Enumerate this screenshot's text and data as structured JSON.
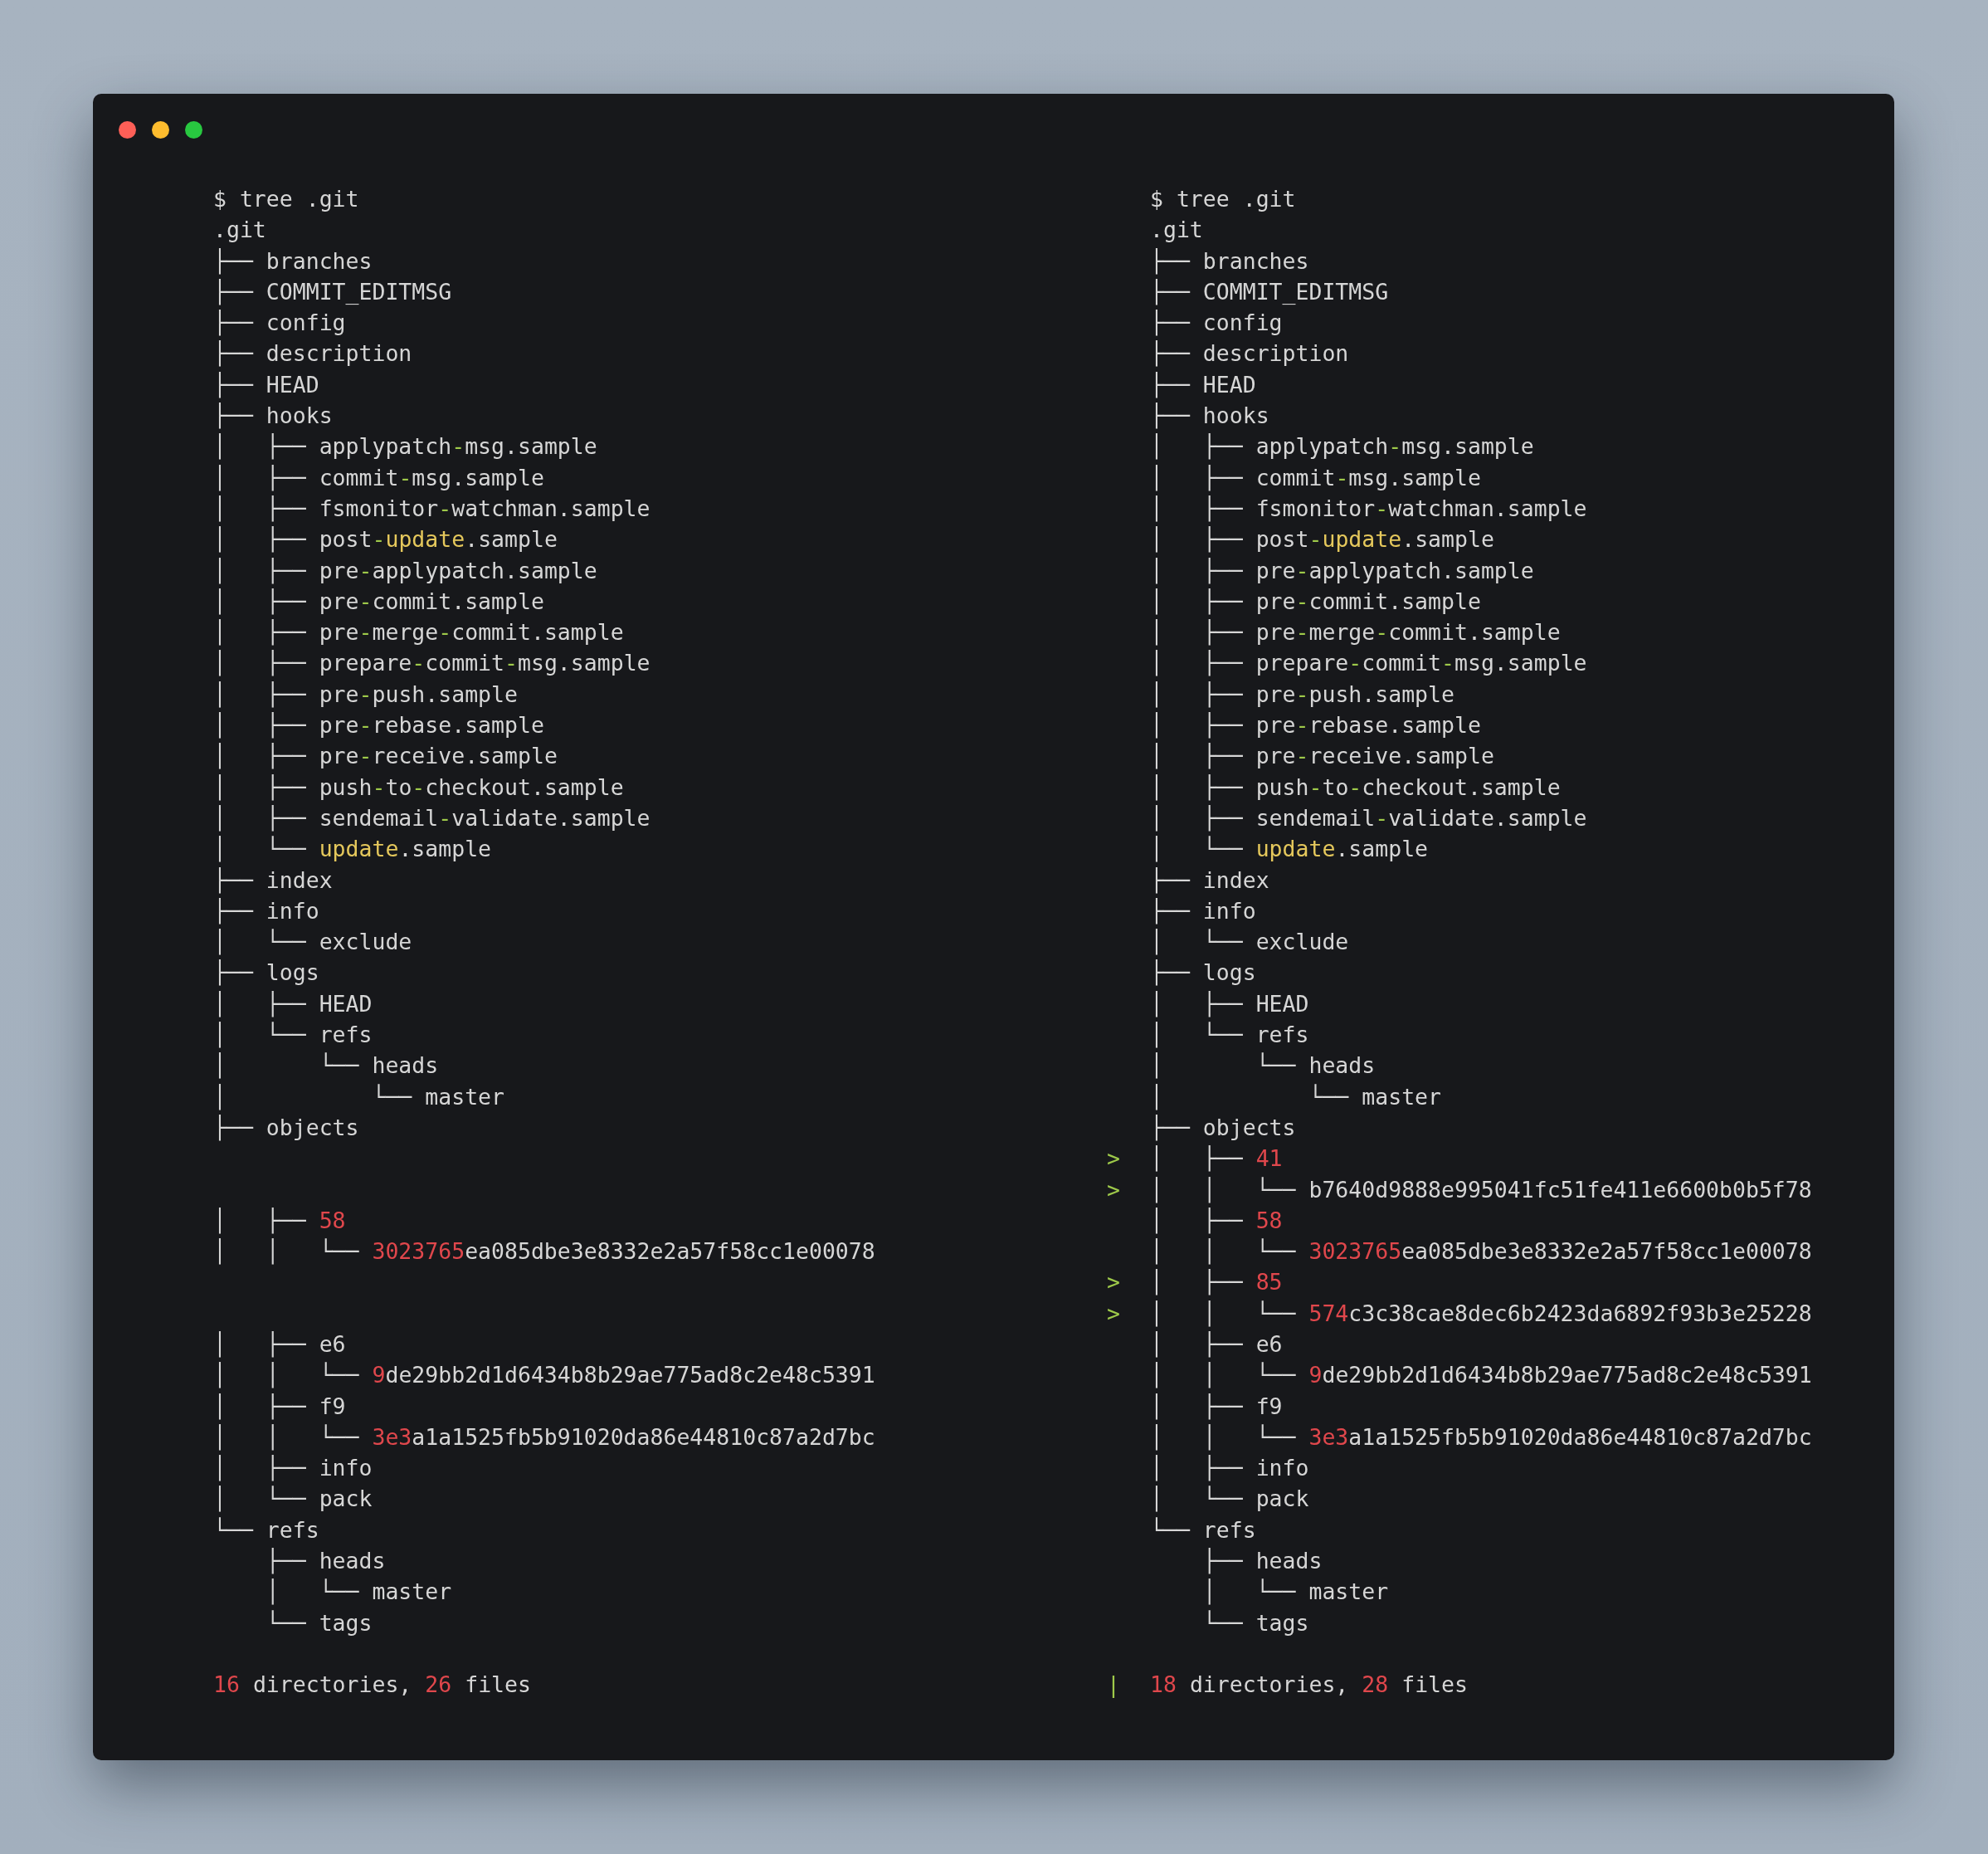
{
  "window": {
    "controls": [
      {
        "kind": "close"
      },
      {
        "kind": "minimize"
      },
      {
        "kind": "zoom"
      }
    ]
  },
  "panes": [
    {
      "rows": [
        {
          "parts": [
            {
              "text": "$ tree .git",
              "kind": "plain"
            }
          ]
        },
        {
          "parts": [
            {
              "text": ".git",
              "kind": "plain"
            }
          ]
        },
        {
          "tree": "├── ",
          "parts": [
            {
              "text": "branches",
              "kind": "plain"
            }
          ]
        },
        {
          "tree": "├── ",
          "parts": [
            {
              "text": "COMMIT_EDITMSG",
              "kind": "plain"
            }
          ]
        },
        {
          "tree": "├── ",
          "parts": [
            {
              "text": "config",
              "kind": "plain"
            }
          ]
        },
        {
          "tree": "├── ",
          "parts": [
            {
              "text": "description",
              "kind": "plain"
            }
          ]
        },
        {
          "tree": "├── ",
          "parts": [
            {
              "text": "HEAD",
              "kind": "plain"
            }
          ]
        },
        {
          "tree": "├── ",
          "parts": [
            {
              "text": "hooks",
              "kind": "plain"
            }
          ]
        },
        {
          "tree": "│   ├── ",
          "parts": [
            {
              "text": "applypatch",
              "kind": "plain"
            },
            {
              "text": "-",
              "kind": "dash"
            },
            {
              "text": "msg.sample",
              "kind": "plain"
            }
          ]
        },
        {
          "tree": "│   ├── ",
          "parts": [
            {
              "text": "commit",
              "kind": "plain"
            },
            {
              "text": "-",
              "kind": "dash"
            },
            {
              "text": "msg.sample",
              "kind": "plain"
            }
          ]
        },
        {
          "tree": "│   ├── ",
          "parts": [
            {
              "text": "fsmonitor",
              "kind": "plain"
            },
            {
              "text": "-",
              "kind": "dash"
            },
            {
              "text": "watchman.sample",
              "kind": "plain"
            }
          ]
        },
        {
          "tree": "│   ├── ",
          "parts": [
            {
              "text": "post",
              "kind": "plain"
            },
            {
              "text": "-",
              "kind": "dash"
            },
            {
              "text": "update",
              "kind": "keyword"
            },
            {
              "text": ".sample",
              "kind": "plain"
            }
          ]
        },
        {
          "tree": "│   ├── ",
          "parts": [
            {
              "text": "pre",
              "kind": "plain"
            },
            {
              "text": "-",
              "kind": "dash"
            },
            {
              "text": "applypatch.sample",
              "kind": "plain"
            }
          ]
        },
        {
          "tree": "│   ├── ",
          "parts": [
            {
              "text": "pre",
              "kind": "plain"
            },
            {
              "text": "-",
              "kind": "dash"
            },
            {
              "text": "commit.sample",
              "kind": "plain"
            }
          ]
        },
        {
          "tree": "│   ├── ",
          "parts": [
            {
              "text": "pre",
              "kind": "plain"
            },
            {
              "text": "-",
              "kind": "dash"
            },
            {
              "text": "merge",
              "kind": "plain"
            },
            {
              "text": "-",
              "kind": "dash"
            },
            {
              "text": "commit.sample",
              "kind": "plain"
            }
          ]
        },
        {
          "tree": "│   ├── ",
          "parts": [
            {
              "text": "prepare",
              "kind": "plain"
            },
            {
              "text": "-",
              "kind": "dash"
            },
            {
              "text": "commit",
              "kind": "plain"
            },
            {
              "text": "-",
              "kind": "dash"
            },
            {
              "text": "msg.sample",
              "kind": "plain"
            }
          ]
        },
        {
          "tree": "│   ├── ",
          "parts": [
            {
              "text": "pre",
              "kind": "plain"
            },
            {
              "text": "-",
              "kind": "dash"
            },
            {
              "text": "push.sample",
              "kind": "plain"
            }
          ]
        },
        {
          "tree": "│   ├── ",
          "parts": [
            {
              "text": "pre",
              "kind": "plain"
            },
            {
              "text": "-",
              "kind": "dash"
            },
            {
              "text": "rebase.sample",
              "kind": "plain"
            }
          ]
        },
        {
          "tree": "│   ├── ",
          "parts": [
            {
              "text": "pre",
              "kind": "plain"
            },
            {
              "text": "-",
              "kind": "dash"
            },
            {
              "text": "receive.sample",
              "kind": "plain"
            }
          ]
        },
        {
          "tree": "│   ├── ",
          "parts": [
            {
              "text": "push",
              "kind": "plain"
            },
            {
              "text": "-",
              "kind": "dash"
            },
            {
              "text": "to",
              "kind": "plain"
            },
            {
              "text": "-",
              "kind": "dash"
            },
            {
              "text": "checkout.sample",
              "kind": "plain"
            }
          ]
        },
        {
          "tree": "│   ├── ",
          "parts": [
            {
              "text": "sendemail",
              "kind": "plain"
            },
            {
              "text": "-",
              "kind": "dash"
            },
            {
              "text": "validate.sample",
              "kind": "plain"
            }
          ]
        },
        {
          "tree": "│   └── ",
          "parts": [
            {
              "text": "update",
              "kind": "keyword"
            },
            {
              "text": ".sample",
              "kind": "plain"
            }
          ]
        },
        {
          "tree": "├── ",
          "parts": [
            {
              "text": "index",
              "kind": "plain"
            }
          ]
        },
        {
          "tree": "├── ",
          "parts": [
            {
              "text": "info",
              "kind": "plain"
            }
          ]
        },
        {
          "tree": "│   └── ",
          "parts": [
            {
              "text": "exclude",
              "kind": "plain"
            }
          ]
        },
        {
          "tree": "├── ",
          "parts": [
            {
              "text": "logs",
              "kind": "plain"
            }
          ]
        },
        {
          "tree": "│   ├── ",
          "parts": [
            {
              "text": "HEAD",
              "kind": "plain"
            }
          ]
        },
        {
          "tree": "│   └── ",
          "parts": [
            {
              "text": "refs",
              "kind": "plain"
            }
          ]
        },
        {
          "tree": "│       └── ",
          "parts": [
            {
              "text": "heads",
              "kind": "plain"
            }
          ]
        },
        {
          "tree": "│           └── ",
          "parts": [
            {
              "text": "master",
              "kind": "plain"
            }
          ]
        },
        {
          "tree": "├── ",
          "parts": [
            {
              "text": "objects",
              "kind": "plain"
            }
          ]
        },
        {
          "kind": "blank"
        },
        {
          "kind": "blank"
        },
        {
          "tree": "│   ├── ",
          "parts": [
            {
              "text": "58",
              "kind": "hash"
            }
          ]
        },
        {
          "tree": "│   │   └── ",
          "parts": [
            {
              "text": "3023765",
              "kind": "hash"
            },
            {
              "text": "ea085dbe3e8332e2a57f58cc1e00078",
              "kind": "plain"
            }
          ]
        },
        {
          "kind": "blank"
        },
        {
          "kind": "blank"
        },
        {
          "tree": "│   ├── ",
          "parts": [
            {
              "text": "e6",
              "kind": "plain"
            }
          ]
        },
        {
          "tree": "│   │   └── ",
          "parts": [
            {
              "text": "9",
              "kind": "hash"
            },
            {
              "text": "de29bb2d1d6434b8b29ae775ad8c2e48c5391",
              "kind": "plain"
            }
          ]
        },
        {
          "tree": "│   ├── ",
          "parts": [
            {
              "text": "f9",
              "kind": "plain"
            }
          ]
        },
        {
          "tree": "│   │   └── ",
          "parts": [
            {
              "text": "3e3",
              "kind": "hash"
            },
            {
              "text": "a1a1525fb5b91020da86e44810c87a2d7bc",
              "kind": "plain"
            }
          ]
        },
        {
          "tree": "│   ├── ",
          "parts": [
            {
              "text": "info",
              "kind": "plain"
            }
          ]
        },
        {
          "tree": "│   └── ",
          "parts": [
            {
              "text": "pack",
              "kind": "plain"
            }
          ]
        },
        {
          "tree": "└── ",
          "parts": [
            {
              "text": "refs",
              "kind": "plain"
            }
          ]
        },
        {
          "tree": "    ├── ",
          "parts": [
            {
              "text": "heads",
              "kind": "plain"
            }
          ]
        },
        {
          "tree": "    │   └── ",
          "parts": [
            {
              "text": "master",
              "kind": "plain"
            }
          ]
        },
        {
          "tree": "    └── ",
          "parts": [
            {
              "text": "tags",
              "kind": "plain"
            }
          ]
        },
        {
          "kind": "blank"
        },
        {
          "parts": [
            {
              "text": "16",
              "kind": "hash"
            },
            {
              "text": " directories, ",
              "kind": "plain"
            },
            {
              "text": "26",
              "kind": "hash"
            },
            {
              "text": " files",
              "kind": "plain"
            }
          ]
        }
      ]
    },
    {
      "rows": [
        {
          "parts": [
            {
              "text": "$ tree .git",
              "kind": "plain"
            }
          ]
        },
        {
          "parts": [
            {
              "text": ".git",
              "kind": "plain"
            }
          ]
        },
        {
          "tree": "├── ",
          "parts": [
            {
              "text": "branches",
              "kind": "plain"
            }
          ]
        },
        {
          "tree": "├── ",
          "parts": [
            {
              "text": "COMMIT_EDITMSG",
              "kind": "plain"
            }
          ]
        },
        {
          "tree": "├── ",
          "parts": [
            {
              "text": "config",
              "kind": "plain"
            }
          ]
        },
        {
          "tree": "├── ",
          "parts": [
            {
              "text": "description",
              "kind": "plain"
            }
          ]
        },
        {
          "tree": "├── ",
          "parts": [
            {
              "text": "HEAD",
              "kind": "plain"
            }
          ]
        },
        {
          "tree": "├── ",
          "parts": [
            {
              "text": "hooks",
              "kind": "plain"
            }
          ]
        },
        {
          "tree": "│   ├── ",
          "parts": [
            {
              "text": "applypatch",
              "kind": "plain"
            },
            {
              "text": "-",
              "kind": "dash"
            },
            {
              "text": "msg.sample",
              "kind": "plain"
            }
          ]
        },
        {
          "tree": "│   ├── ",
          "parts": [
            {
              "text": "commit",
              "kind": "plain"
            },
            {
              "text": "-",
              "kind": "dash"
            },
            {
              "text": "msg.sample",
              "kind": "plain"
            }
          ]
        },
        {
          "tree": "│   ├── ",
          "parts": [
            {
              "text": "fsmonitor",
              "kind": "plain"
            },
            {
              "text": "-",
              "kind": "dash"
            },
            {
              "text": "watchman.sample",
              "kind": "plain"
            }
          ]
        },
        {
          "tree": "│   ├── ",
          "parts": [
            {
              "text": "post",
              "kind": "plain"
            },
            {
              "text": "-",
              "kind": "dash"
            },
            {
              "text": "update",
              "kind": "keyword"
            },
            {
              "text": ".sample",
              "kind": "plain"
            }
          ]
        },
        {
          "tree": "│   ├── ",
          "parts": [
            {
              "text": "pre",
              "kind": "plain"
            },
            {
              "text": "-",
              "kind": "dash"
            },
            {
              "text": "applypatch.sample",
              "kind": "plain"
            }
          ]
        },
        {
          "tree": "│   ├── ",
          "parts": [
            {
              "text": "pre",
              "kind": "plain"
            },
            {
              "text": "-",
              "kind": "dash"
            },
            {
              "text": "commit.sample",
              "kind": "plain"
            }
          ]
        },
        {
          "tree": "│   ├── ",
          "parts": [
            {
              "text": "pre",
              "kind": "plain"
            },
            {
              "text": "-",
              "kind": "dash"
            },
            {
              "text": "merge",
              "kind": "plain"
            },
            {
              "text": "-",
              "kind": "dash"
            },
            {
              "text": "commit.sample",
              "kind": "plain"
            }
          ]
        },
        {
          "tree": "│   ├── ",
          "parts": [
            {
              "text": "prepare",
              "kind": "plain"
            },
            {
              "text": "-",
              "kind": "dash"
            },
            {
              "text": "commit",
              "kind": "plain"
            },
            {
              "text": "-",
              "kind": "dash"
            },
            {
              "text": "msg.sample",
              "kind": "plain"
            }
          ]
        },
        {
          "tree": "│   ├── ",
          "parts": [
            {
              "text": "pre",
              "kind": "plain"
            },
            {
              "text": "-",
              "kind": "dash"
            },
            {
              "text": "push.sample",
              "kind": "plain"
            }
          ]
        },
        {
          "tree": "│   ├── ",
          "parts": [
            {
              "text": "pre",
              "kind": "plain"
            },
            {
              "text": "-",
              "kind": "dash"
            },
            {
              "text": "rebase.sample",
              "kind": "plain"
            }
          ]
        },
        {
          "tree": "│   ├── ",
          "parts": [
            {
              "text": "pre",
              "kind": "plain"
            },
            {
              "text": "-",
              "kind": "dash"
            },
            {
              "text": "receive.sample",
              "kind": "plain"
            }
          ]
        },
        {
          "tree": "│   ├── ",
          "parts": [
            {
              "text": "push",
              "kind": "plain"
            },
            {
              "text": "-",
              "kind": "dash"
            },
            {
              "text": "to",
              "kind": "plain"
            },
            {
              "text": "-",
              "kind": "dash"
            },
            {
              "text": "checkout.sample",
              "kind": "plain"
            }
          ]
        },
        {
          "tree": "│   ├── ",
          "parts": [
            {
              "text": "sendemail",
              "kind": "plain"
            },
            {
              "text": "-",
              "kind": "dash"
            },
            {
              "text": "validate.sample",
              "kind": "plain"
            }
          ]
        },
        {
          "tree": "│   └── ",
          "parts": [
            {
              "text": "update",
              "kind": "keyword"
            },
            {
              "text": ".sample",
              "kind": "plain"
            }
          ]
        },
        {
          "tree": "├── ",
          "parts": [
            {
              "text": "index",
              "kind": "plain"
            }
          ]
        },
        {
          "tree": "├── ",
          "parts": [
            {
              "text": "info",
              "kind": "plain"
            }
          ]
        },
        {
          "tree": "│   └── ",
          "parts": [
            {
              "text": "exclude",
              "kind": "plain"
            }
          ]
        },
        {
          "tree": "├── ",
          "parts": [
            {
              "text": "logs",
              "kind": "plain"
            }
          ]
        },
        {
          "tree": "│   ├── ",
          "parts": [
            {
              "text": "HEAD",
              "kind": "plain"
            }
          ]
        },
        {
          "tree": "│   └── ",
          "parts": [
            {
              "text": "refs",
              "kind": "plain"
            }
          ]
        },
        {
          "tree": "│       └── ",
          "parts": [
            {
              "text": "heads",
              "kind": "plain"
            }
          ]
        },
        {
          "tree": "│           └── ",
          "parts": [
            {
              "text": "master",
              "kind": "plain"
            }
          ]
        },
        {
          "tree": "├── ",
          "parts": [
            {
              "text": "objects",
              "kind": "plain"
            }
          ]
        },
        {
          "marker": ">",
          "tree": "│   ├── ",
          "parts": [
            {
              "text": "41",
              "kind": "hash"
            }
          ]
        },
        {
          "marker": ">",
          "tree": "│   │   └── ",
          "parts": [
            {
              "text": "b7640d9888e995041fc51fe411e6600b0b5f78",
              "kind": "plain"
            }
          ]
        },
        {
          "tree": "│   ├── ",
          "parts": [
            {
              "text": "58",
              "kind": "hash"
            }
          ]
        },
        {
          "tree": "│   │   └── ",
          "parts": [
            {
              "text": "3023765",
              "kind": "hash"
            },
            {
              "text": "ea085dbe3e8332e2a57f58cc1e00078",
              "kind": "plain"
            }
          ]
        },
        {
          "marker": ">",
          "tree": "│   ├── ",
          "parts": [
            {
              "text": "85",
              "kind": "hash"
            }
          ]
        },
        {
          "marker": ">",
          "tree": "│   │   └── ",
          "parts": [
            {
              "text": "574",
              "kind": "hash"
            },
            {
              "text": "c3c38cae8dec6b2423da6892f93b3e25228",
              "kind": "plain"
            }
          ]
        },
        {
          "tree": "│   ├── ",
          "parts": [
            {
              "text": "e6",
              "kind": "plain"
            }
          ]
        },
        {
          "tree": "│   │   └── ",
          "parts": [
            {
              "text": "9",
              "kind": "hash"
            },
            {
              "text": "de29bb2d1d6434b8b29ae775ad8c2e48c5391",
              "kind": "plain"
            }
          ]
        },
        {
          "tree": "│   ├── ",
          "parts": [
            {
              "text": "f9",
              "kind": "plain"
            }
          ]
        },
        {
          "tree": "│   │   └── ",
          "parts": [
            {
              "text": "3e3",
              "kind": "hash"
            },
            {
              "text": "a1a1525fb5b91020da86e44810c87a2d7bc",
              "kind": "plain"
            }
          ]
        },
        {
          "tree": "│   ├── ",
          "parts": [
            {
              "text": "info",
              "kind": "plain"
            }
          ]
        },
        {
          "tree": "│   └── ",
          "parts": [
            {
              "text": "pack",
              "kind": "plain"
            }
          ]
        },
        {
          "tree": "└── ",
          "parts": [
            {
              "text": "refs",
              "kind": "plain"
            }
          ]
        },
        {
          "tree": "    ├── ",
          "parts": [
            {
              "text": "heads",
              "kind": "plain"
            }
          ]
        },
        {
          "tree": "    │   └── ",
          "parts": [
            {
              "text": "master",
              "kind": "plain"
            }
          ]
        },
        {
          "tree": "    └── ",
          "parts": [
            {
              "text": "tags",
              "kind": "plain"
            }
          ]
        },
        {
          "kind": "blank"
        },
        {
          "marker": "|",
          "parts": [
            {
              "text": "18",
              "kind": "hash"
            },
            {
              "text": " directories, ",
              "kind": "plain"
            },
            {
              "text": "28",
              "kind": "hash"
            },
            {
              "text": " files",
              "kind": "plain"
            }
          ]
        }
      ]
    }
  ]
}
